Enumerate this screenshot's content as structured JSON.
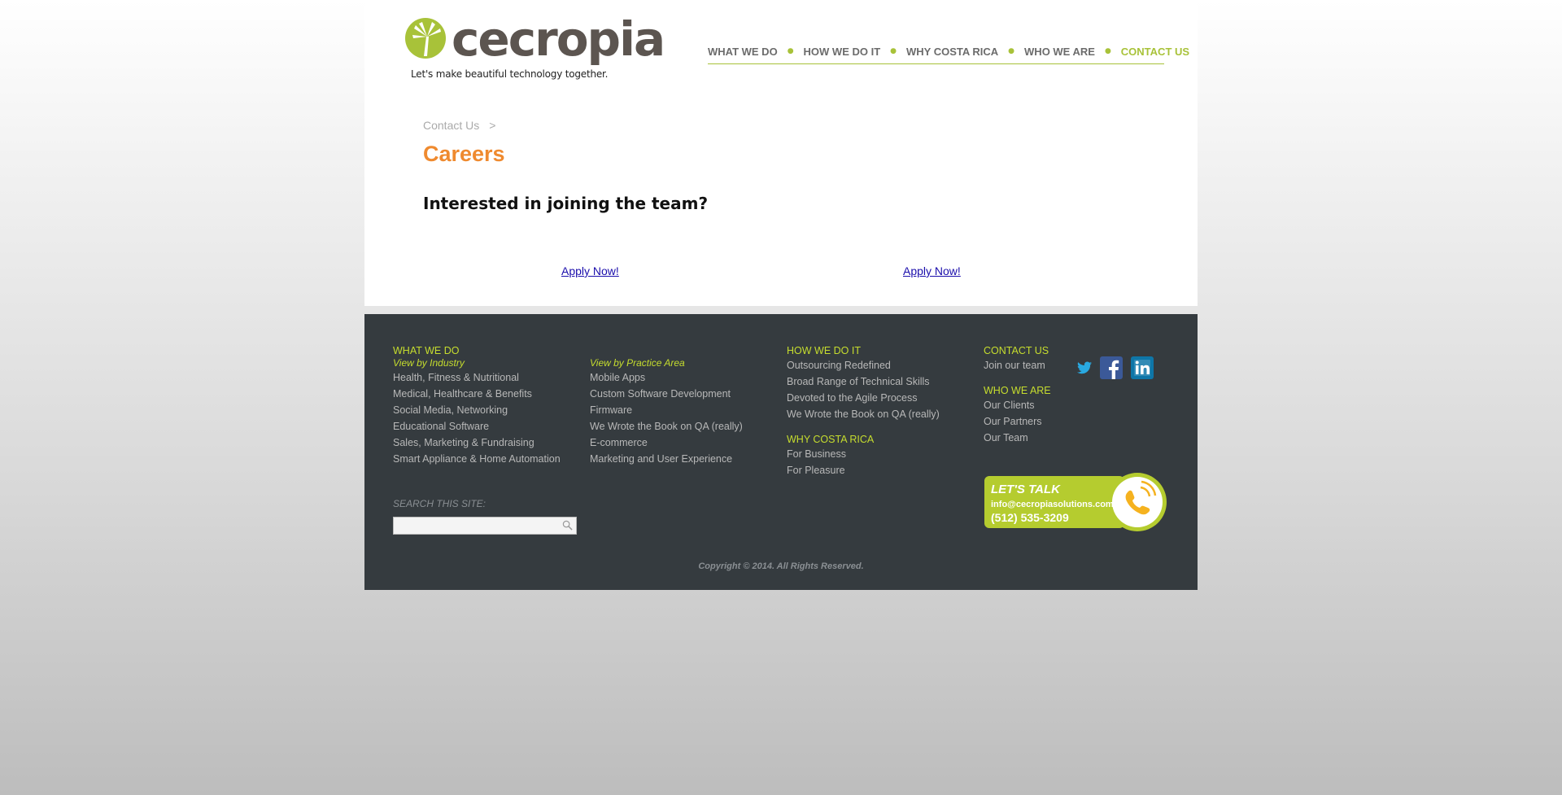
{
  "brand": {
    "name": "cecropia",
    "tagline": "Let's make beautiful technology together.",
    "accent": "#a8c239",
    "orange": "#ef8a2f"
  },
  "nav": {
    "items": [
      {
        "label": "WHAT WE DO"
      },
      {
        "label": "HOW WE DO IT"
      },
      {
        "label": "WHY COSTA RICA"
      },
      {
        "label": "WHO WE ARE"
      },
      {
        "label": "CONTACT US"
      }
    ],
    "active": "CONTACT US"
  },
  "breadcrumb": {
    "parent": "Contact Us",
    "separator": ">"
  },
  "page": {
    "title": "Careers",
    "heading": "Interested in joining the team?",
    "apply_left": "Apply Now!",
    "apply_right": "Apply Now!"
  },
  "footer": {
    "col1": {
      "heading": "WHAT WE DO",
      "subheading": "View by Industry",
      "links": [
        "Health, Fitness & Nutritional",
        "Medical, Healthcare & Benefits",
        "Social Media, Networking",
        "Educational Software",
        "Sales, Marketing & Fundraising",
        "Smart Appliance & Home Automation"
      ]
    },
    "col2": {
      "subheading": "View by Practice Area",
      "links": [
        "Mobile Apps",
        "Custom Software Development",
        "Firmware",
        "We Wrote the Book on QA (really)",
        "E-commerce",
        "Marketing and User Experience"
      ]
    },
    "col3": {
      "heading": "HOW WE DO IT",
      "links": [
        "Outsourcing Redefined",
        "Broad Range of Technical Skills",
        "Devoted to the Agile Process",
        "We Wrote the Book on QA (really)"
      ],
      "heading2": "WHY COSTA RICA",
      "links2": [
        "For Business",
        "For Pleasure"
      ]
    },
    "col4": {
      "heading": "CONTACT US",
      "links": [
        "Join our team"
      ],
      "heading2": "WHO WE ARE",
      "links2": [
        "Our Clients",
        "Our Partners",
        "Our Team"
      ]
    },
    "search_label": "SEARCH THIS SITE:",
    "search_placeholder": "",
    "social": [
      "twitter-icon",
      "facebook-icon",
      "linkedin-icon"
    ],
    "talk": {
      "title": "LET'S TALK",
      "email": "info@cecropiasolutions.com",
      "phone": "(512) 535-3209"
    },
    "copyright": "Copyright © 2014. All Rights Reserved."
  }
}
